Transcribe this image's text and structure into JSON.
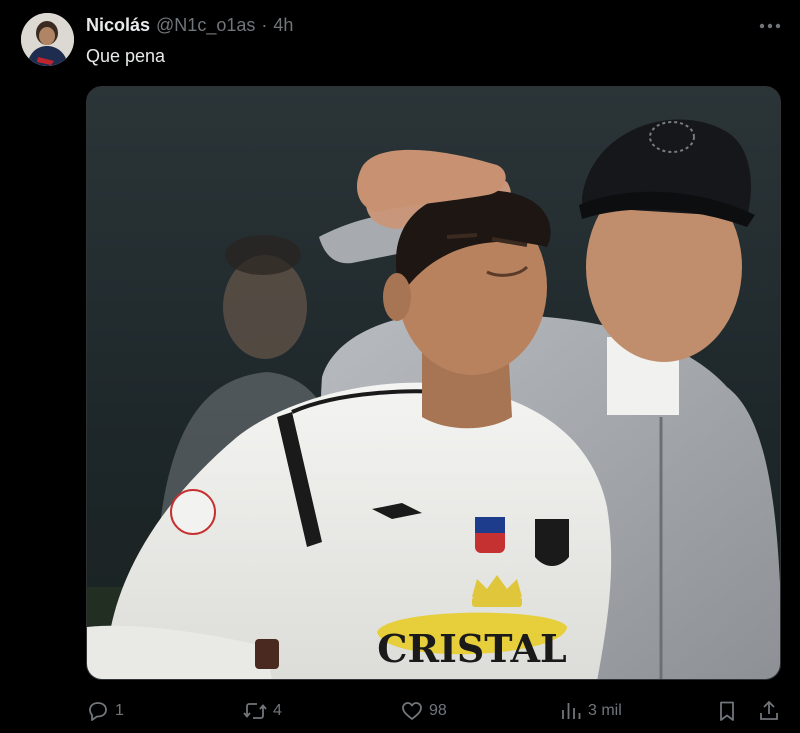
{
  "tweet": {
    "author_name": "Nicolás",
    "author_handle": "@N1c_o1as",
    "separator": "·",
    "time": "4h",
    "text": "Que pena"
  },
  "icons": {
    "more": "more-horizontal-icon",
    "reply": "reply-icon",
    "retweet": "retweet-icon",
    "like": "heart-icon",
    "views": "views-chart-icon",
    "bookmark": "bookmark-icon",
    "share": "share-icon"
  },
  "actions": {
    "replies": "1",
    "retweets": "4",
    "likes": "98",
    "views": "3 mil"
  },
  "media": {
    "jersey_text": "CRISTAL"
  },
  "colors": {
    "background": "#000000",
    "primary_text": "#e7e9ea",
    "secondary_text": "#71767b",
    "border": "#2f3336"
  }
}
